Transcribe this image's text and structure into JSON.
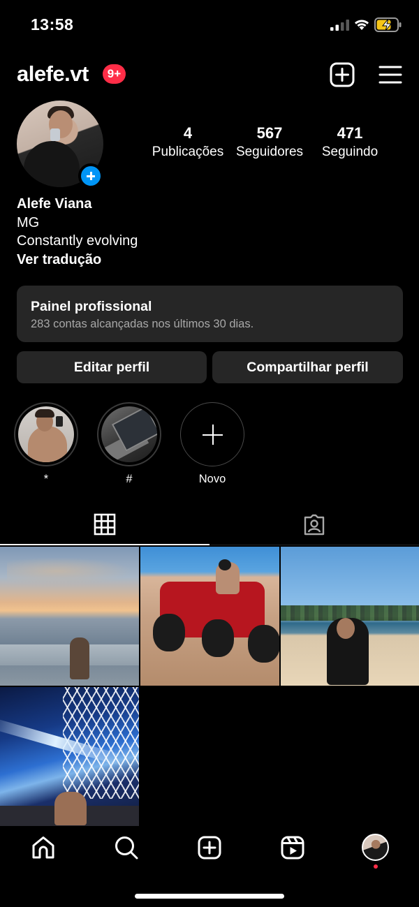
{
  "status_bar": {
    "time": "13:58"
  },
  "header": {
    "username": "alefe.vt",
    "notifications_badge": "9+"
  },
  "stats": [
    {
      "value": "4",
      "label": "Publicações"
    },
    {
      "value": "567",
      "label": "Seguidores"
    },
    {
      "value": "471",
      "label": "Seguindo"
    }
  ],
  "bio": {
    "name": "Alefe Viana",
    "line1": "MG",
    "line2": "Constantly evolving",
    "translate": "Ver tradução"
  },
  "professional_panel": {
    "title": "Painel profissional",
    "subtitle": "283 contas alcançadas nos últimos 30 dias."
  },
  "buttons": {
    "edit": "Editar perfil",
    "share": "Compartilhar perfil"
  },
  "highlights": [
    {
      "label": "*"
    },
    {
      "label": "#"
    },
    {
      "label": "Novo"
    }
  ],
  "tabs": {
    "active": "grid",
    "icons": [
      "grid-icon",
      "tagged-icon"
    ]
  },
  "posts_count": 4,
  "bottom_nav": {
    "icons": [
      "home-icon",
      "search-icon",
      "add-icon",
      "reels-icon",
      "profile-avatar"
    ]
  },
  "colors": {
    "accent": "#0095f6",
    "badge": "#ff2d47",
    "surface": "#262626",
    "background": "#000000"
  }
}
